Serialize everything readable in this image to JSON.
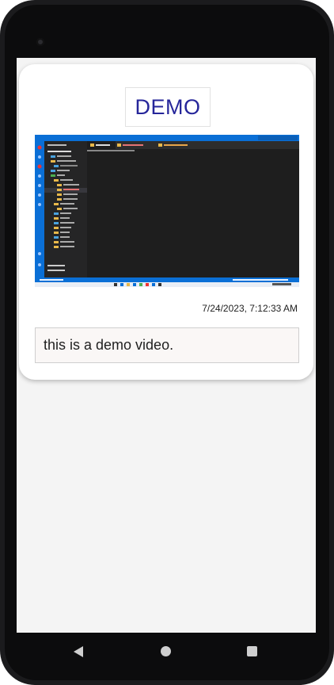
{
  "card": {
    "title": "DEMO",
    "timestamp": "7/24/2023, 7:12:33 AM",
    "description": "this is a demo video."
  },
  "thumbnail": {
    "subject": "video thumbnail showing a code editor window"
  },
  "nav": {
    "back_icon": "back-triangle",
    "home_icon": "home-circle",
    "recents_icon": "recents-square"
  }
}
